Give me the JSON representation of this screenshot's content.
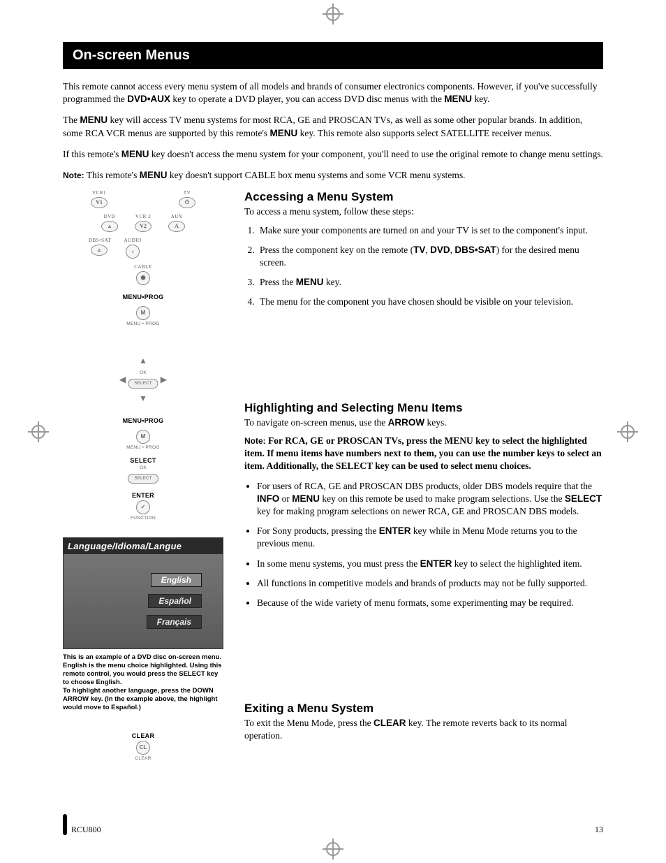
{
  "header": {
    "title": "On-screen Menus"
  },
  "intro": {
    "p1_a": "This remote cannot access every menu system of all models and brands of consumer electronics components. However, if you've successfully programmed the ",
    "p1_b": "DVD•AUX",
    "p1_c": " key to operate a DVD player, you can access DVD disc menus with the ",
    "p1_d": "MENU",
    "p1_e": " key.",
    "p2_a": "The ",
    "p2_b": "MENU",
    "p2_c": " key will access TV menu systems for most RCA, GE and PROSCAN TVs, as well as some other popular brands. In addition, some RCA VCR menus are supported by this remote's ",
    "p2_d": "MENU",
    "p2_e": " key. This remote also supports select SATELLITE receiver menus.",
    "p3_a": "If this remote's ",
    "p3_b": "MENU",
    "p3_c": " key doesn't access the menu system for your component, you'll need to use the original remote to change menu settings.",
    "p4_label": "Note:",
    "p4_a": " This remote's ",
    "p4_b": "MENU",
    "p4_c": " key doesn't support CABLE box menu systems and some VCR menu systems."
  },
  "remote_labels": {
    "vcr1": "VCR1",
    "tv": "TV",
    "dvd": "DVD",
    "vcr2": "VCR 2",
    "aux": "AUX",
    "dbssat": "DBS•SAT",
    "audio": "AUDIO",
    "cable": "CABLE",
    "menu_prog": "MENU•PROG",
    "menu_prog_sub": "MENU • PROG",
    "select": "SELECT",
    "enter": "ENTER",
    "clear": "CLEAR",
    "ok": "OK"
  },
  "dvd_menu": {
    "title": "Language/Idioma/Langue",
    "opt1": "English",
    "opt2": "Español",
    "opt3": "Français"
  },
  "caption": {
    "p1": "This is an example of a DVD disc on-screen menu. English is the menu choice highlighted. Using this remote control, you would press the SELECT key to choose English.",
    "p2": "To highlight another language, press the DOWN ARROW key. (In the example above, the highlight would move to Español.)"
  },
  "access": {
    "h": "Accessing a Menu System",
    "lead": "To access a menu system, follow these steps:",
    "s1": "Make sure your components are turned on and your TV is set to the component's input.",
    "s2_a": "Press the component key on the remote (",
    "s2_b": "TV",
    "s2_c": ", ",
    "s2_d": "DVD",
    "s2_e": ", ",
    "s2_f": "DBS•SAT",
    "s2_g": ") for the desired menu screen.",
    "s3_a": "Press the ",
    "s3_b": "MENU",
    "s3_c": " key.",
    "s4": "The menu for the component you have chosen should be visible on your television."
  },
  "highlight": {
    "h": "Highlighting and Selecting Menu Items",
    "lead_a": "To navigate on-screen menus, use the ",
    "lead_b": "ARROW",
    "lead_c": " keys.",
    "note_label": "Note: ",
    "note": "For RCA, GE or PROSCAN TVs, press the MENU key to select the highlighted item. If menu items have numbers next to them, you can use the number keys to select an item. Additionally, the SELECT key can be used to select menu choices.",
    "b1_a": "For users of RCA, GE and PROSCAN DBS products, older DBS models require that the ",
    "b1_b": "INFO",
    "b1_c": " or ",
    "b1_d": "MENU",
    "b1_e": " key on this remote be used to make program selections. Use the ",
    "b1_f": "SELECT",
    "b1_g": " key for making program selections on newer RCA, GE and PROSCAN DBS models.",
    "b2_a": "For Sony products, pressing the ",
    "b2_b": "ENTER",
    "b2_c": " key while in Menu Mode returns you to the previous menu.",
    "b3_a": "In some menu systems, you must press the ",
    "b3_b": "ENTER",
    "b3_c": " key to select the highlighted item.",
    "b4": "All functions in competitive models and brands of products may not be fully supported.",
    "b5": "Because of the wide variety of menu formats, some experimenting may be required."
  },
  "exit": {
    "h": "Exiting a Menu System",
    "p_a": "To exit the Menu Mode, press the ",
    "p_b": "CLEAR",
    "p_c": " key. The remote reverts back to its normal operation."
  },
  "footer": {
    "model": "RCU800",
    "page": "13"
  }
}
